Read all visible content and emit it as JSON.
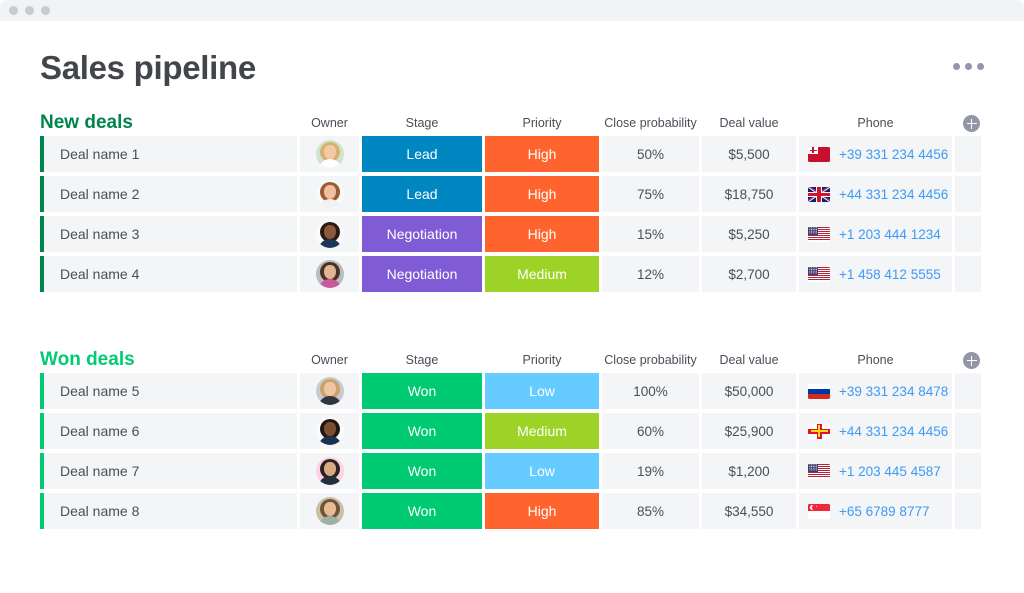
{
  "window": {
    "traffic_lights": [
      "close",
      "minimize",
      "maximize"
    ]
  },
  "header": {
    "title": "Sales pipeline",
    "more_menu_icon": "kebab-horizontal-icon"
  },
  "colors": {
    "stage_lead": "#0086c0",
    "stage_negotiation": "#7f5bd5",
    "stage_won": "#00ca72",
    "priority_high": "#ff642e",
    "priority_medium": "#9cd326",
    "priority_low": "#66ccff",
    "group_new": "#00854d",
    "group_won": "#00ca72",
    "link": "#3d9bf5",
    "row_bg": "#f4f5f7",
    "text": "#4b4e57"
  },
  "columns": [
    {
      "key": "name",
      "label": ""
    },
    {
      "key": "owner",
      "label": "Owner"
    },
    {
      "key": "stage",
      "label": "Stage"
    },
    {
      "key": "priority",
      "label": "Priority"
    },
    {
      "key": "probability",
      "label": "Close probability"
    },
    {
      "key": "value",
      "label": "Deal value"
    },
    {
      "key": "phone",
      "label": "Phone"
    }
  ],
  "add_column_icon": "plus-circle-icon",
  "groups": [
    {
      "title": "New deals",
      "color": "#00854d",
      "accent": "#00854d",
      "headers": {
        "owner": "Owner",
        "stage": "Stage",
        "priority": "Priority",
        "probability": "Close probability",
        "value": "Deal value",
        "phone": "Phone"
      },
      "rows": [
        {
          "name": "Deal name 1",
          "owner_avatar": "avatar-woman-blonde",
          "stage": "Lead",
          "stage_color": "#0086c0",
          "priority": "High",
          "priority_color": "#ff642e",
          "probability": "50%",
          "value": "$5,500",
          "flag": "tonga-flag",
          "phone": "+39 331 234 4456"
        },
        {
          "name": "Deal name 2",
          "owner_avatar": "avatar-woman-redhead",
          "stage": "Lead",
          "stage_color": "#0086c0",
          "priority": "High",
          "priority_color": "#ff642e",
          "probability": "75%",
          "value": "$18,750",
          "flag": "united-kingdom-flag",
          "phone": "+44 331 234 4456"
        },
        {
          "name": "Deal name 3",
          "owner_avatar": "avatar-man-beard-navy",
          "stage": "Negotiation",
          "stage_color": "#7f5bd5",
          "priority": "High",
          "priority_color": "#ff642e",
          "probability": "15%",
          "value": "$5,250",
          "flag": "united-states-flag",
          "phone": "+1 203 444 1234"
        },
        {
          "name": "Deal name 4",
          "owner_avatar": "avatar-man-beard-floral",
          "stage": "Negotiation",
          "stage_color": "#7f5bd5",
          "priority": "Medium",
          "priority_color": "#9cd326",
          "probability": "12%",
          "value": "$2,700",
          "flag": "united-states-flag",
          "phone": "+1 458 412 5555"
        }
      ]
    },
    {
      "title": "Won deals",
      "color": "#00ca72",
      "accent": "#00ca72",
      "headers": {
        "owner": "Owner",
        "stage": "Stage",
        "priority": "Priority",
        "probability": "Close probability",
        "value": "Deal value",
        "phone": "Phone"
      },
      "rows": [
        {
          "name": "Deal name 5",
          "owner_avatar": "avatar-man-blond",
          "stage": "Won",
          "stage_color": "#00ca72",
          "priority": "Low",
          "priority_color": "#66ccff",
          "probability": "100%",
          "value": "$50,000",
          "flag": "russia-flag",
          "phone": "+39 331 234 8478"
        },
        {
          "name": "Deal name 6",
          "owner_avatar": "avatar-man-glasses-navy",
          "stage": "Won",
          "stage_color": "#00ca72",
          "priority": "Medium",
          "priority_color": "#9cd326",
          "probability": "60%",
          "value": "$25,900",
          "flag": "guernsey-flag",
          "phone": "+44 331 234 4456"
        },
        {
          "name": "Deal name 7",
          "owner_avatar": "avatar-woman-dark-pink",
          "stage": "Won",
          "stage_color": "#00ca72",
          "priority": "Low",
          "priority_color": "#66ccff",
          "probability": "19%",
          "value": "$1,200",
          "flag": "united-states-flag",
          "phone": "+1 203 445 4587"
        },
        {
          "name": "Deal name 8",
          "owner_avatar": "avatar-woman-brunette",
          "stage": "Won",
          "stage_color": "#00ca72",
          "priority": "High",
          "priority_color": "#ff642e",
          "probability": "85%",
          "value": "$34,550",
          "flag": "singapore-flag",
          "phone": "+65 6789 8777"
        }
      ]
    }
  ]
}
